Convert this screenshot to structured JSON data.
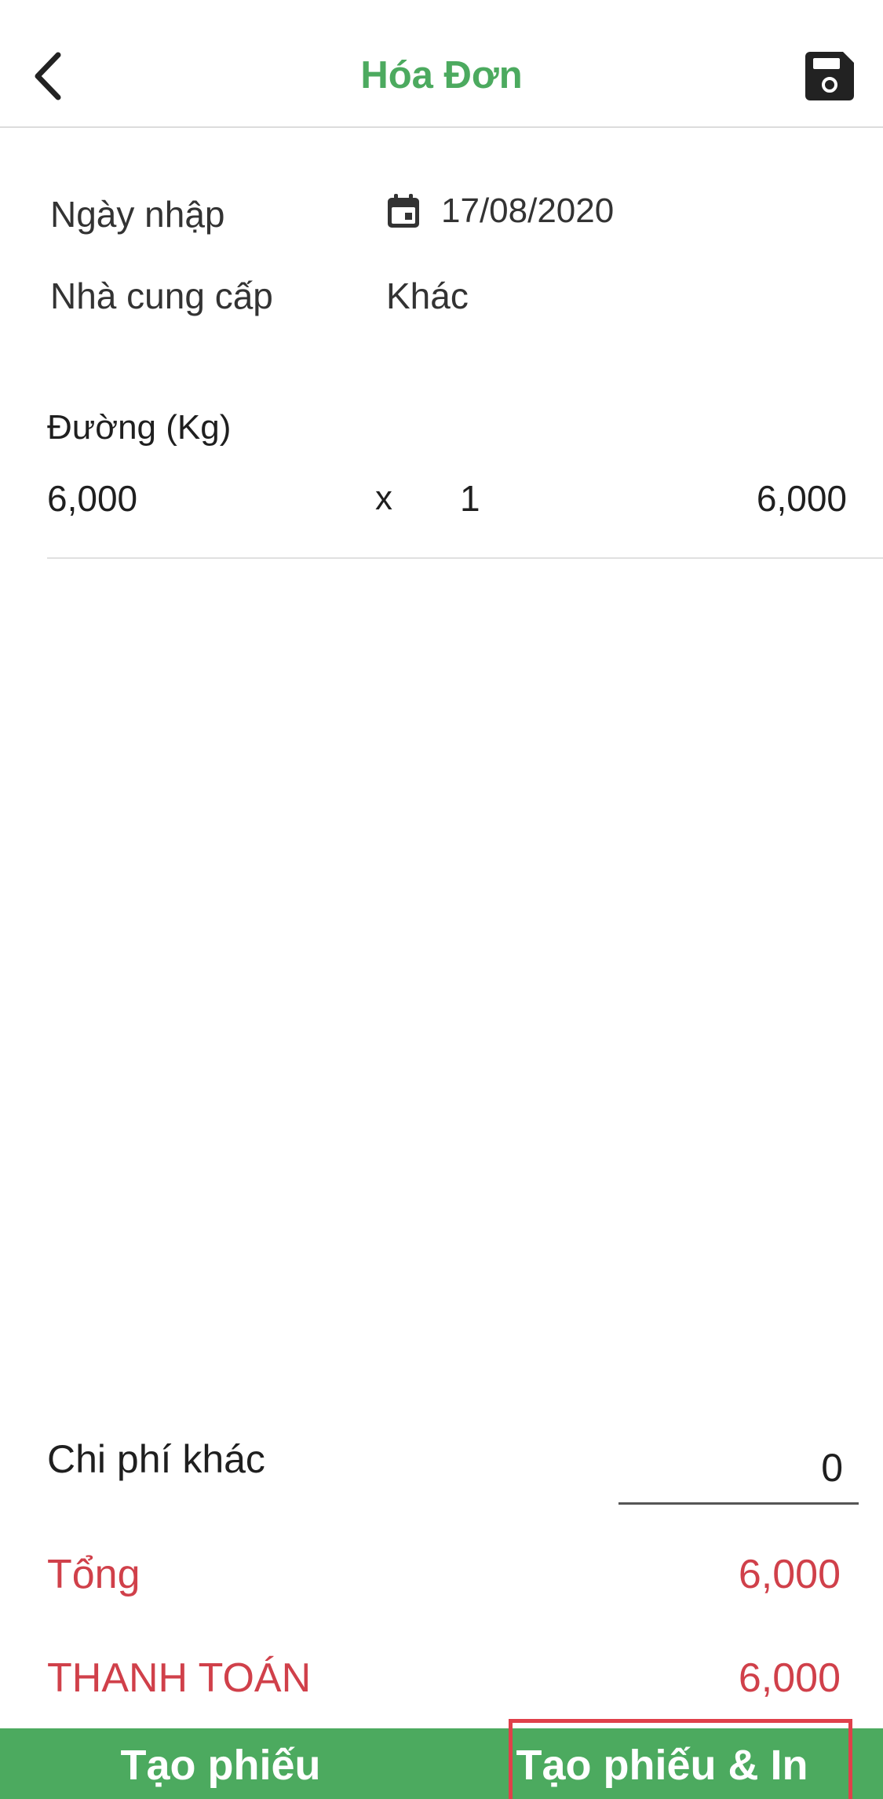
{
  "header": {
    "title": "Hóa Đơn",
    "back_icon": "chevron-left-icon",
    "save_icon": "floppy-disk-icon"
  },
  "info": {
    "date_label": "Ngày nhập",
    "date_value": "17/08/2020",
    "date_icon": "calendar-icon",
    "supplier_label": "Nhà cung cấp",
    "supplier_value": "Khác"
  },
  "items": [
    {
      "name": "Đường (Kg)",
      "price": "6,000",
      "times": "x",
      "quantity": "1",
      "total": "6,000"
    }
  ],
  "summary": {
    "other_cost_label": "Chi phí khác",
    "other_cost_value": "0",
    "total_label": "Tổng",
    "total_value": "6,000",
    "payment_label": "THANH TOÁN",
    "payment_value": "6,000"
  },
  "footer": {
    "create_label": "Tạo phiếu",
    "create_print_label": "Tạo phiếu & In"
  },
  "colors": {
    "brand_green": "#4caa5f",
    "total_red": "#d0404a",
    "highlight_red": "#e0404a"
  }
}
